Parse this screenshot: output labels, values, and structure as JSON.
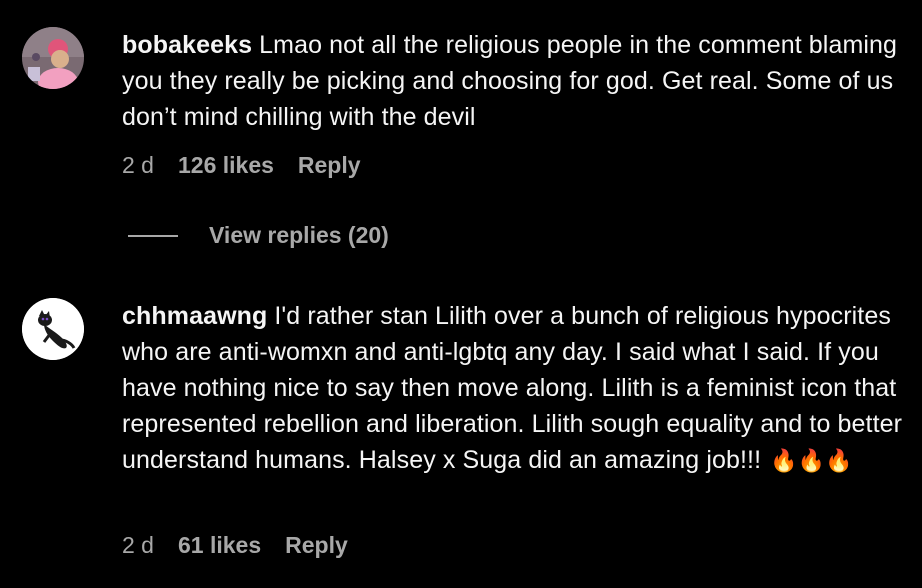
{
  "comments": [
    {
      "username": "bobakeeks",
      "text": "Lmao not all the religious people in the comment blaming you they really be picking and choosing for god. Get real. Some of us don’t mind chilling with the devil",
      "age": "2 d",
      "likes": "126 likes",
      "reply_label": "Reply",
      "avatar_icon": "profile-photo"
    },
    {
      "username": "chhmaawng",
      "text": "I'd rather stan Lilith over a bunch of religious hypocrites who are anti-womxn and anti-lgbtq any day. I said what I said. If you have nothing nice to say then move along. Lilith is a feminist icon that represented rebellion and liberation. Lilith sough equality and to better understand humans. Halsey x Suga did an amazing job!!!",
      "emoji": "🔥🔥🔥",
      "age": "2 d",
      "likes": "61 likes",
      "reply_label": "Reply",
      "avatar_icon": "black-cat-icon"
    }
  ],
  "view_replies": {
    "label": "View replies (20)"
  },
  "colors": {
    "background": "#000000",
    "text": "#f5f5f5",
    "secondary": "#a8a8a8"
  }
}
